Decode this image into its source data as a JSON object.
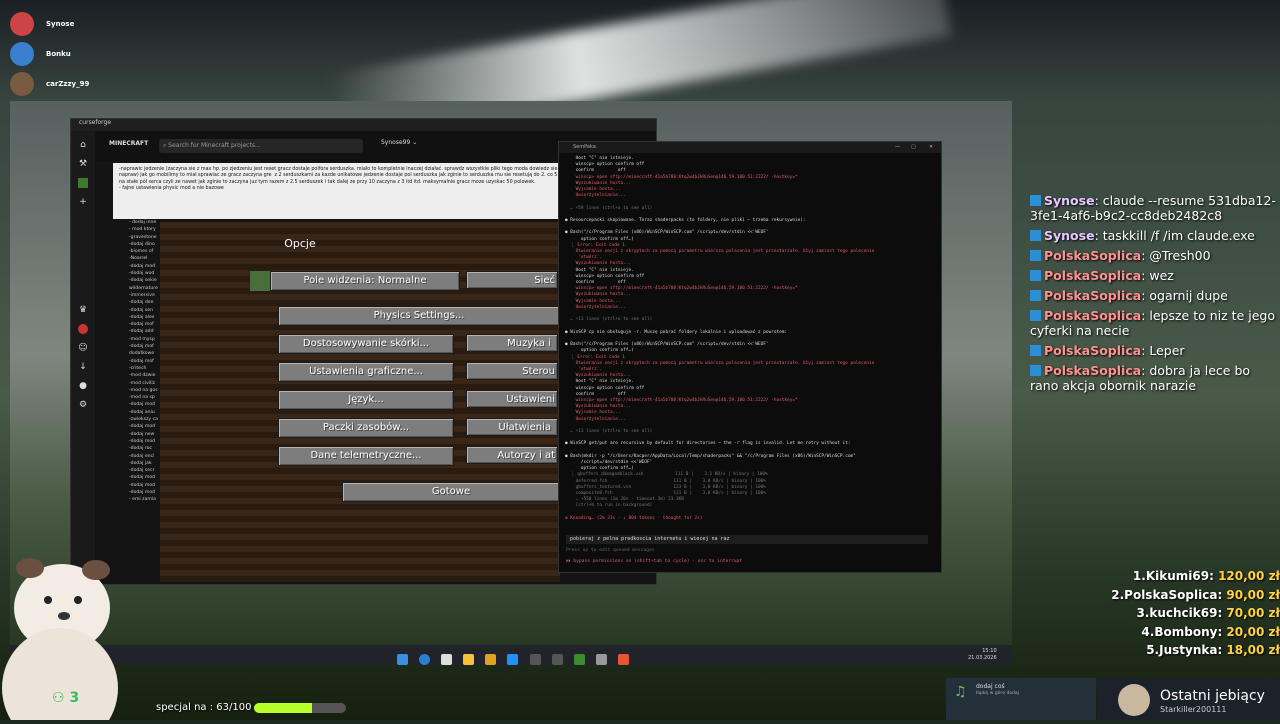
{
  "top_users": [
    "Synose",
    "Bonku",
    "carZzzy_99"
  ],
  "curseforge": {
    "title": "curseforge",
    "search_placeholder": "Search for Minecraft projects...",
    "user": "Synose99",
    "logo": "MINECRAFT",
    "notes": "-naprawic jedzenie (zaczyna sie z max hp. po zjedzeniu jest reset gracz dostaje polfora serduszka. miało to kompletnie inaczej działać. sprawdz wszystkie pliki tego moda dowiedz sie jak powinien on dzialac i go napraw) jak go mobilimy to mial sprawiac ze gracz zaczyna gre  z 2 serduszkami za kazde unikatowe jedzenie dostaje pol serduszka jak zginie to serduszka mu sie resetują do 2. co 5 unikatowych jedzen dostaje na stałe pół serca czyli ze nawet jak zginie to zaczyna juz tym razem z 2.5 serduszek i tak dalej ze przy 10 zaczyna z 3 itd itd. maksymalnie gracz moze uzyskac 50 polowek.\n- fajne ustawienia physic mod a nie bazowe",
    "list": [
      "- dodaj inne",
      "- mod ktory",
      "-gravestone",
      "-dodaj dino",
      "-biomes of",
      "-Noarrel",
      "-dodaj mod",
      "-dodaj wod",
      "-dodaj sekie",
      "wildernature",
      "-immersive",
      "-dodaj dee",
      "-dodaj sen",
      "-dodaj alex",
      "-dodaj mof",
      "-dodaj add",
      "-mod mysp",
      "-dodaj mof",
      "dodatkowe",
      "-dodaj mof",
      "-critech",
      "-mod dzwie",
      "-mod civiliz",
      "-mod na gos",
      "-mod na sp",
      "-dodaj mod",
      "-dodaj aniu",
      "-zwiekszy ca",
      "-dodaj mod",
      "-dodaj new",
      "-dodaj mod",
      "-dodaj roc",
      "-dodaj enci",
      "-dodaj jak",
      "-dodaj secr",
      "-dodaj mod",
      "-dodaj mod",
      "-dodaj mod",
      "- emi zamia"
    ]
  },
  "minecraft": {
    "title": "Opcje",
    "fov": "Pole widzenia: Normalne",
    "physics": "Physics Settings...",
    "skins": "Dostosowywanie skórki...",
    "graphics": "Ustawienia graficzne...",
    "language": "Język...",
    "resources": "Paczki zasobów...",
    "telemetry": "Dane telemetryczne...",
    "done": "Gotowe",
    "right": [
      "Sieć",
      "Muzyka i",
      "Sterou",
      "Ustawieni",
      "Ułatwienia",
      "Autorzy i at"
    ]
  },
  "terminal": {
    "title": "SemPaka",
    "lines": [
      {
        "c": "white",
        "t": "    Host \"C\" nie istnieje."
      },
      {
        "c": "white",
        "t": "    winscp> option confirm off"
      },
      {
        "c": "white",
        "t": "    confirm         off"
      },
      {
        "c": "red",
        "t": "    winscp> open sftp://minecraft-41a5b788:Ktq2w4bJkRuSen@146.59.100.51:2222/ -hostkey=*"
      },
      {
        "c": "red",
        "t": "    Wyszukiwanie hosta..."
      },
      {
        "c": "red",
        "t": "    Wyjsamie hosta..."
      },
      {
        "c": "red",
        "t": "    Uwierzytelnianie..."
      },
      {
        "c": "grey",
        "t": ""
      },
      {
        "c": "grey",
        "t": "  … +59 lines (ctrl+o to see all)"
      },
      {
        "c": "grey",
        "t": ""
      },
      {
        "c": "white",
        "t": "● Resourcepacki skopiowane. Teraz shaderpacks (to foldery, nie pliki — trzeba rekursywnie):"
      },
      {
        "c": "grey",
        "t": ""
      },
      {
        "c": "white",
        "t": "● Bash(\"/c/Program Files (x86)/WinSCP/WinSCP.com\" /script=/dev/stdin <<'WEOF'"
      },
      {
        "c": "white",
        "t": "      option confirm off…)"
      },
      {
        "c": "red",
        "t": "  ⎿ Error: Exit code 1"
      },
      {
        "c": "red",
        "t": "    Otwieranie sesji z skryptach za pomocą parametru wiersza polecenia jest przestarzałe. Użyj zamiast tego polecenia"
      },
      {
        "c": "red",
        "t": "     'otwórz'."
      },
      {
        "c": "red",
        "t": "    Wyszukiwanie hosta..."
      },
      {
        "c": "white",
        "t": "    Host \"C\" nie istnieje."
      },
      {
        "c": "white",
        "t": "    winscp> option confirm off"
      },
      {
        "c": "white",
        "t": "    confirm         off"
      },
      {
        "c": "red",
        "t": "    winscp> open sftp://minecraft-41a5b788:Ktq2w4bJkRuSen@146.59.100.51:2222/ -hostkey=*"
      },
      {
        "c": "red",
        "t": "    Wyszukiwanie hosta..."
      },
      {
        "c": "red",
        "t": "    Wyjsamie hosta..."
      },
      {
        "c": "red",
        "t": "    Uwierzytelnianie..."
      },
      {
        "c": "grey",
        "t": ""
      },
      {
        "c": "grey",
        "t": "  … +11 lines (ctrl+o to see all)"
      },
      {
        "c": "grey",
        "t": ""
      },
      {
        "c": "white",
        "t": "● WinSCP cp nie obsługuje -r. Muszę pobrać foldery lokalnie i uploadować z powrotem:"
      },
      {
        "c": "grey",
        "t": ""
      },
      {
        "c": "white",
        "t": "● Bash(\"/c/Program Files (x86)/WinSCP/WinSCP.com\" /script=/dev/stdin <<'WEOF'"
      },
      {
        "c": "white",
        "t": "      option confirm off…)"
      },
      {
        "c": "red",
        "t": "  ⎿ Error: Exit code 1"
      },
      {
        "c": "red",
        "t": "    Otwieranie sesji z skryptach za pomocą parametru wiersza polecenia jest przestarzałe. Użyj zamiast tego polecenia"
      },
      {
        "c": "red",
        "t": "     'otwórz'."
      },
      {
        "c": "red",
        "t": "    Wyszukiwanie hosta..."
      },
      {
        "c": "white",
        "t": "    Host \"C\" nie istnieje."
      },
      {
        "c": "white",
        "t": "    winscp> option confirm off"
      },
      {
        "c": "white",
        "t": "    confirm         off"
      },
      {
        "c": "red",
        "t": "    winscp> open sftp://minecraft-41a5b788:Ktq2w4bJkRuSen@146.59.100.51:2222/ -hostkey=*"
      },
      {
        "c": "red",
        "t": "    Wyszukiwanie hosta..."
      },
      {
        "c": "red",
        "t": "    Wyjsamie hosta..."
      },
      {
        "c": "red",
        "t": "    Uwierzytelnianie..."
      },
      {
        "c": "grey",
        "t": ""
      },
      {
        "c": "grey",
        "t": "  … +11 lines (ctrl+o to see all)"
      },
      {
        "c": "grey",
        "t": ""
      },
      {
        "c": "white",
        "t": "● WinSCP get/put are recursive by default for directories — the -r flag is invalid. Let me retry without it:"
      },
      {
        "c": "grey",
        "t": ""
      },
      {
        "c": "white",
        "t": "● Bash(mkdir -p \"/c/Users/Kacper/AppData/Local/Temp/shaderpacks\" && \"/c/Program Files (x86)/WinSCP/WinSCP.com\""
      },
      {
        "c": "white",
        "t": "      /script=/dev/stdin <<'WEOF'"
      },
      {
        "c": "white",
        "t": "      option confirm off…)"
      },
      {
        "c": "grey",
        "t": "  ⎿ gbuffers_damagedblock.vsh            111 B |    3,1 KB/s | binary | 100%"
      },
      {
        "c": "grey",
        "t": "    deferred.fsh                         111 B |    3,0 KB/s | binary | 100%"
      },
      {
        "c": "grey",
        "t": "    gbuffers_textured.vsh                123 B |    3,0 KB/s | binary | 100%"
      },
      {
        "c": "grey",
        "t": "    composite8.fsh                       111 B |    3,0 KB/s | binary | 100%"
      },
      {
        "c": "grey",
        "t": "    … +550 lines (1m 20s · timeout 3m) 23.3KB"
      },
      {
        "c": "grey",
        "t": "    (ctrl+b to run in background)"
      },
      {
        "c": "grey",
        "t": ""
      },
      {
        "c": "red",
        "t": "✻ Kneading… (2m 33s · ↓ 804 tokens · thought for 2s)"
      }
    ],
    "queued": "pobieraj z pelna predkoscia internetu i wiecej na raz",
    "input_placeholder": "Press up to edit queued messages",
    "bypass": "⏵⏵ bypass permissions on (shift+tab to cycle) · esc to interrupt"
  },
  "chat": [
    {
      "nick": "Synose",
      "style": "a",
      "text": "claude --resume 531dba12-3fe1-4af6-b9c2-cc8deb2482c8"
    },
    {
      "nick": "Synose",
      "style": "a",
      "text": "taskkill /f /im claude.exe"
    },
    {
      "nick": "PolskaSoplica",
      "style": "b",
      "text": "@Tresh00"
    },
    {
      "nick": "PolskaSoplica",
      "style": "b",
      "text": "wez"
    },
    {
      "nick": "PolskaSoplica",
      "style": "b",
      "text": "ogarnij dupe"
    },
    {
      "nick": "PolskaSoplica",
      "style": "b",
      "text": "lepsze to niz te jego cyferki na necie"
    },
    {
      "nick": "PolskaSoplica",
      "style": "b",
      "text": "Leper"
    },
    {
      "nick": "PolskaSoplica",
      "style": "b",
      "text": "dobra ja lece bo rano akcja obornik narazie"
    }
  ],
  "donations": [
    {
      "rank": "1.",
      "name": "Kikumi69:",
      "amount": "120,00 zł"
    },
    {
      "rank": "2.",
      "name": "PolskaSoplica:",
      "amount": "90,00 zł"
    },
    {
      "rank": "3.",
      "name": "kuchcik69:",
      "amount": "70,00 zł"
    },
    {
      "rank": "4.",
      "name": "Bombony:",
      "amount": "20,00 zł"
    },
    {
      "rank": "5.",
      "name": "Justynka:",
      "amount": "18,00 zł"
    }
  ],
  "special": {
    "label": "specjal na : 63/100",
    "progress": 0.63
  },
  "last_sub": {
    "title": "Ostatni jebiący",
    "user": "Starkiller200111"
  },
  "music": {
    "title": "dodaj coś",
    "sub": "łapkę w górę dodaj"
  },
  "viewers": "3",
  "clock": {
    "time": "15:10",
    "date": "21.03.2026"
  },
  "colors": {
    "accent": "#b6ff28",
    "chat_nick_a": "#e6c7ff",
    "chat_nick_b": "#ff9090",
    "donation": "#ffd23f"
  }
}
